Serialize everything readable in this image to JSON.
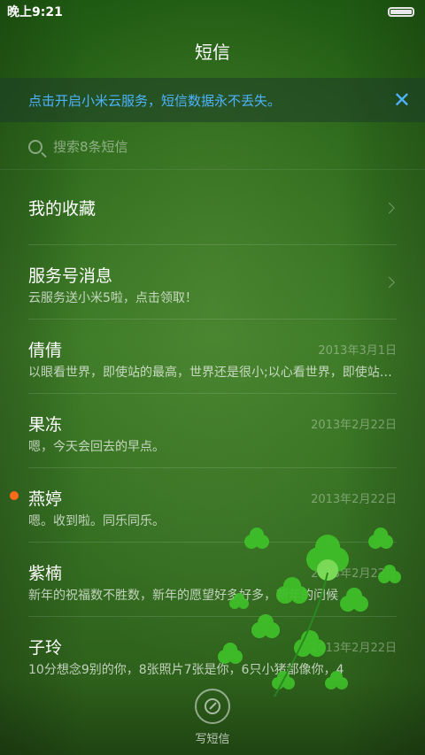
{
  "status_bar": {
    "time": "晚上9:21"
  },
  "header": {
    "title": "短信"
  },
  "banner": {
    "text": "点击开启小米云服务，短信数据永不丢失。",
    "close_glyph": "✕"
  },
  "search": {
    "placeholder": "搜索8条短信"
  },
  "list": {
    "favorites": {
      "name": "我的收藏"
    },
    "service": {
      "name": "服务号消息",
      "preview": "云服务送小米5啦，点击领取！"
    },
    "threads": [
      {
        "name": "倩倩",
        "date": "2013年3月1日",
        "preview": "以眼看世界，即使站的最高，世界还是很小;以心看世界，即使站的最低，世界也是很大。"
      },
      {
        "name": "果冻",
        "date": "2013年2月22日",
        "preview": "嗯，今天会回去的早点。"
      },
      {
        "name": "燕婷",
        "date": "2013年2月22日",
        "preview": "嗯。收到啦。同乐同乐。",
        "unread": true
      },
      {
        "name": "紫楠",
        "date": "2013年2月22日",
        "preview": "新年的祝福数不胜数，新年的愿望好多好多，新年的问候"
      },
      {
        "name": "子玲",
        "date": "2013年2月22日",
        "preview": "10分想念9别的你，8张照片7张是你，6只小猪都像你，4"
      }
    ]
  },
  "bottom": {
    "compose_label": "写短信",
    "compose_icon": "compose-icon"
  },
  "colors": {
    "banner_text": "#4db3ff",
    "unread_dot": "#ff6a1a"
  }
}
